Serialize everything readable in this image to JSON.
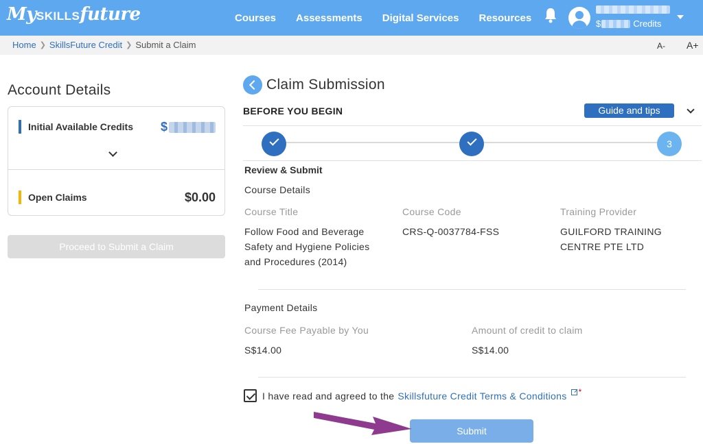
{
  "header": {
    "logo_main": "My",
    "logo_skills": "SKILLS",
    "logo_future": "future",
    "nav": [
      "Courses",
      "Assessments",
      "Digital Services",
      "Resources"
    ],
    "credits_prefix": "$",
    "credits_suffix": "Credits",
    "icons": [
      "bell-icon",
      "user-avatar-icon",
      "caret-down-icon"
    ]
  },
  "breadcrumb": {
    "home": "Home",
    "parent": "SkillsFuture Credit",
    "current": "Submit a Claim",
    "font_decrease": "A-",
    "font_increase": "A+"
  },
  "account": {
    "title": "Account Details",
    "initial_label": "Initial Available Credits",
    "initial_prefix": "$",
    "open_claims_label": "Open Claims",
    "open_claims_amount": "$0.00",
    "proceed_label": "Proceed to Submit a Claim",
    "bar_colors": {
      "initial": "#2f6fc0",
      "open": "#f2b705"
    }
  },
  "claim": {
    "title": "Claim Submission",
    "before_you_begin": "BEFORE YOU BEGIN",
    "guide_label": "Guide and tips",
    "steps": [
      {
        "state": "done"
      },
      {
        "state": "done"
      },
      {
        "state": "current",
        "number": "3"
      }
    ],
    "review_title": "Review & Submit",
    "course_section": "Course Details",
    "course_title_label": "Course Title",
    "course_title_value": "Follow Food and Beverage Safety and Hygiene Policies and Procedures (2014)",
    "course_code_label": "Course Code",
    "course_code_value": "CRS-Q-0037784-FSS",
    "provider_label": "Training Provider",
    "provider_value": "GUILFORD TRAINING CENTRE PTE LTD",
    "payment_section": "Payment Details",
    "fee_label": "Course Fee Payable by You",
    "fee_value": "S$14.00",
    "credit_label": "Amount of credit to claim",
    "credit_value": "S$14.00",
    "terms_prefix": "I have read and agreed to the",
    "terms_link": "Skillsfuture Credit Terms & Conditions",
    "terms_required": "*",
    "submit_label": "Submit",
    "accent_color": "#2f6fc0",
    "arrow_color": "#8e3b8f"
  }
}
